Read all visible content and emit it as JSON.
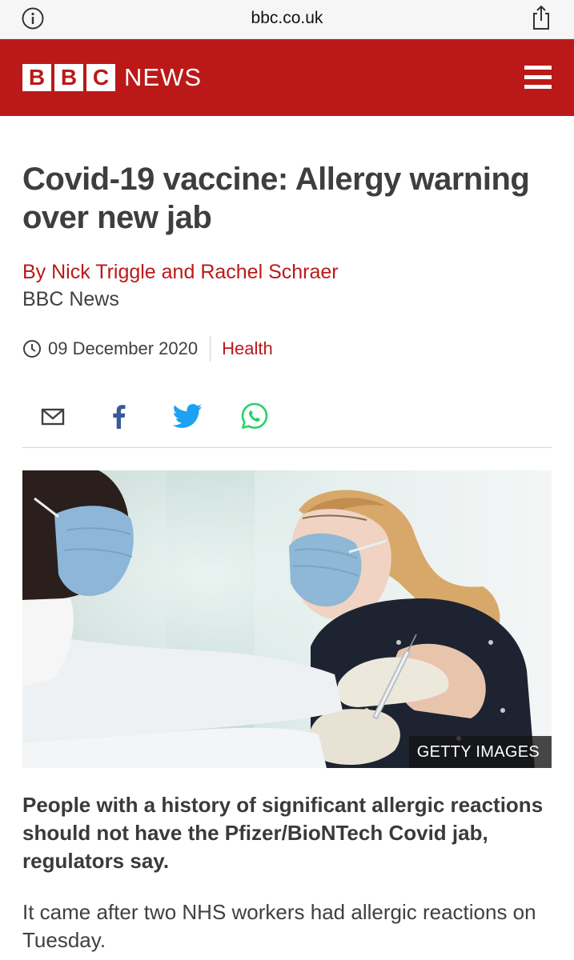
{
  "browser": {
    "url": "bbc.co.uk",
    "info_icon": "info-circle-icon",
    "share_icon": "share-icon"
  },
  "header": {
    "logo_letters": [
      "B",
      "B",
      "C"
    ],
    "logo_word": "NEWS",
    "menu_icon": "hamburger-menu-icon",
    "brand_color": "#bb1919"
  },
  "article": {
    "headline": "Covid-19 vaccine: Allergy warning over new jab",
    "byline": "By Nick Triggle and Rachel Schraer",
    "byline_org": "BBC News",
    "date": "09 December 2020",
    "section": "Health",
    "share_icons": [
      "email-icon",
      "facebook-icon",
      "twitter-icon",
      "whatsapp-icon"
    ],
    "image_credit": "GETTY IMAGES",
    "intro": "People with a history of significant allergic reactions should not have the Pfizer/BioNTech Covid jab, regulators say.",
    "body": "It came after two NHS workers had allergic reactions on Tuesday."
  }
}
